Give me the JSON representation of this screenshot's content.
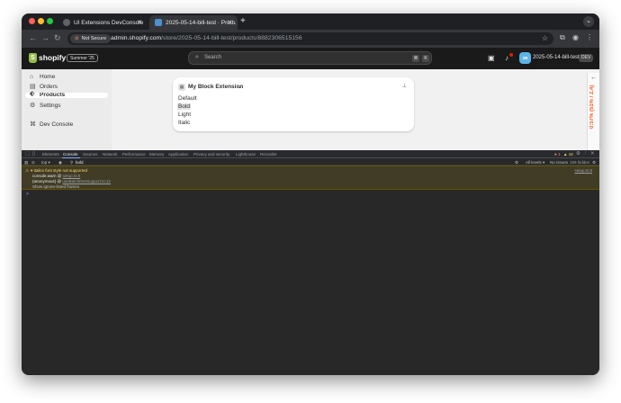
{
  "browser": {
    "tabs": [
      {
        "title": "UI Extensions DevConsole",
        "active": false
      },
      {
        "title": "2025-05-14-bill-test · Produ",
        "active": true
      }
    ],
    "security_label": "Not Secure",
    "url_host": "admin.shopify.com",
    "url_path": "/store/2025-05-14-bill-test/products/8882306515156"
  },
  "shopify": {
    "logo_text": "shopify",
    "edition_badge": "Summer '25",
    "search_placeholder": "Search",
    "kbd_1": "⌘",
    "kbd_2": "K",
    "avatar_initials": "2B",
    "store_name": "2025-05-14-bill-test",
    "dev_badge": "DEV"
  },
  "sidebar": {
    "items": [
      {
        "label": "Home",
        "icon": "home-icon"
      },
      {
        "label": "Orders",
        "icon": "inbox-icon"
      },
      {
        "label": "Products",
        "icon": "tag-icon"
      },
      {
        "label": "Settings",
        "icon": "gear-icon"
      }
    ],
    "dev_console": "Dev Console"
  },
  "block": {
    "title": "My Block Extension",
    "options": [
      "Default",
      "Bold",
      "Light",
      "Italic"
    ],
    "selected": "Bold"
  },
  "ruler": {
    "text": "0:57% (51% / 2.4)"
  },
  "devtools": {
    "tabs": [
      "Elements",
      "Console",
      "Sources",
      "Network",
      "Performance",
      "Memory",
      "Application",
      "Privacy and security",
      "Lighthouse",
      "Recorder"
    ],
    "active_tab": "Console",
    "error_count": "1",
    "warning_count": "16",
    "context": "top",
    "filter_text": "bold",
    "levels": "All levels",
    "issues": "No Issues",
    "hidden": "199 hidden",
    "warning": {
      "message": "Italics font style not supported",
      "line1_fn": "console.warn",
      "line1_src": "setup.ts:8",
      "line2_fn": "(anonymous)",
      "line2_src": "useBatchDevSupport.ts:12",
      "line3": "Show ignore-listed frames",
      "source": "setup.ts:8"
    },
    "prompt": ">"
  },
  "colors": {
    "shopify_green": "#95bf47",
    "warning_bg": "#413c26",
    "warning_text": "#fdd663",
    "ruler_text": "#ff5a1f"
  }
}
